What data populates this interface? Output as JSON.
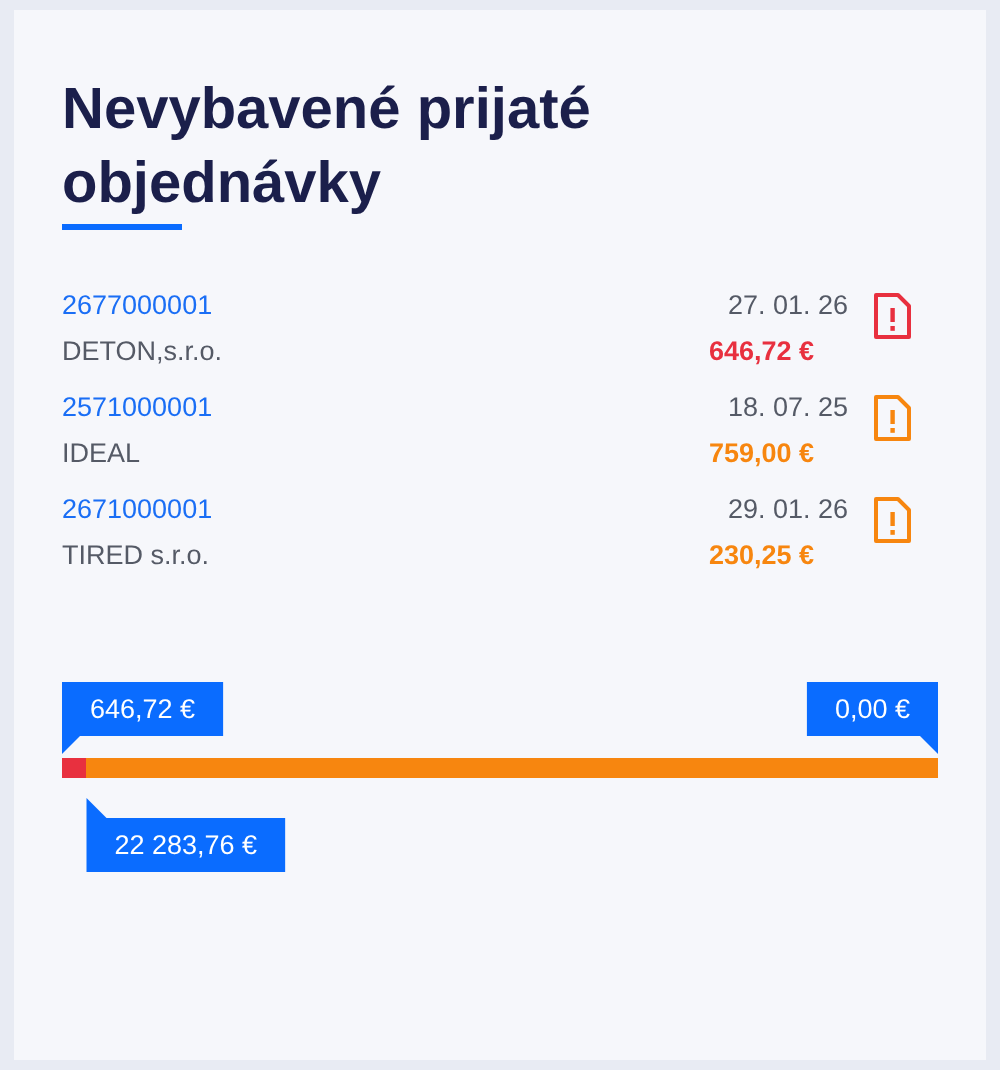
{
  "title": "Nevybavené prijaté objednávky",
  "orders": [
    {
      "number": "2677000001",
      "company": "DETON,s.r.o.",
      "date": "27. 01. 26",
      "amount": "646,72 €",
      "color": "#e8303f"
    },
    {
      "number": "2571000001",
      "company": "IDEAL",
      "date": "18. 07. 25",
      "amount": "759,00 €",
      "color": "#f7860f"
    },
    {
      "number": "2671000001",
      "company": "TIRED s.r.o.",
      "date": "29. 01. 26",
      "amount": "230,25 €",
      "color": "#f7860f"
    }
  ],
  "bar": {
    "segments": [
      {
        "level": 0.028,
        "color": "#e8303f"
      },
      {
        "level": 0.972,
        "color": "#f7860f"
      }
    ],
    "markers": [
      {
        "kind": "start",
        "text": "646,72 €"
      },
      {
        "kind": "end",
        "text": "0,00 €"
      },
      {
        "kind": "split",
        "text": "22 283,76 €"
      }
    ]
  }
}
